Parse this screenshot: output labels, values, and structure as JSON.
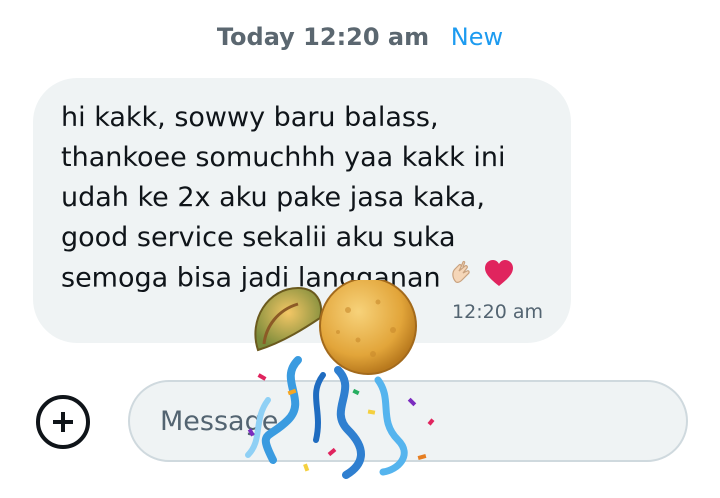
{
  "conversation": {
    "date_label": "Today 12:20 am",
    "new_label": "New"
  },
  "message": {
    "text": "hi kakk, sowwy baru balass,\nthankoee somuchhh yaa kakk ini\nudah ke 2x aku pake jasa kaka,\ngood service sekalii aku suka\nsemoga bisa jadi langganan",
    "emojis": [
      "heart-hands-emoji",
      "red-heart-emoji"
    ],
    "time": "12:20 am"
  },
  "composer": {
    "placeholder": "Message",
    "add_icon": "plus-circle-icon"
  },
  "sticker": {
    "icon": "confetti-popper-sticker"
  },
  "colors": {
    "accent": "#1d9bf0",
    "bubble": "#eff3f4",
    "text": "#0f1419",
    "muted": "#536471",
    "heart": "#e0245e"
  }
}
